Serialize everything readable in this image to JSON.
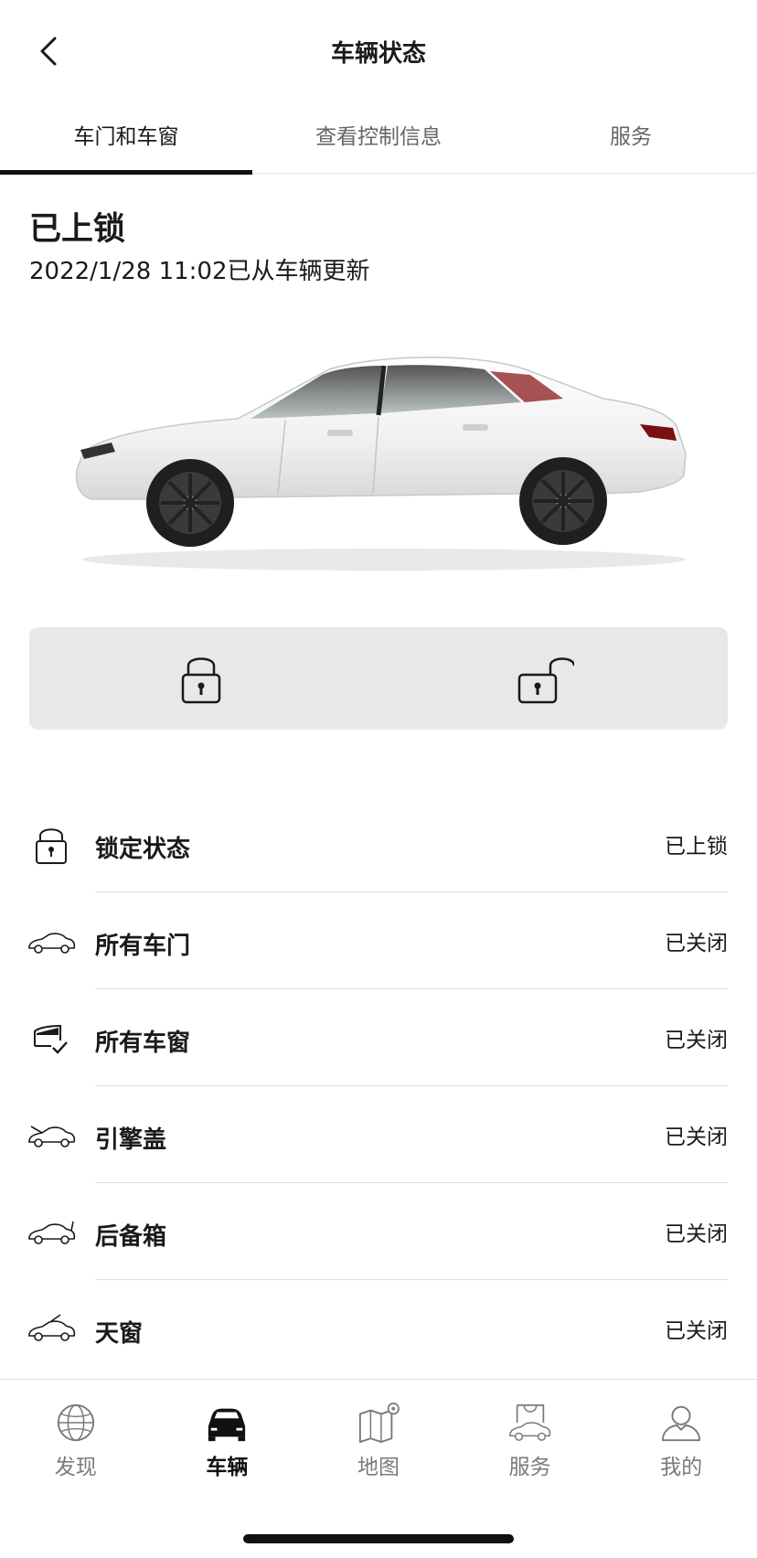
{
  "header": {
    "title": "车辆状态"
  },
  "tabs": [
    {
      "label": "车门和车窗",
      "active": true
    },
    {
      "label": "查看控制信息",
      "active": false
    },
    {
      "label": "服务",
      "active": false
    }
  ],
  "status": {
    "title": "已上锁",
    "updated": "2022/1/28 11:02已从车辆更新"
  },
  "lock_panel": {
    "lock_icon": "lock-closed-icon",
    "unlock_icon": "lock-open-icon"
  },
  "items": [
    {
      "icon": "lock-icon",
      "label": "锁定状态",
      "value": "已上锁"
    },
    {
      "icon": "car-door-icon",
      "label": "所有车门",
      "value": "已关闭"
    },
    {
      "icon": "car-window-icon",
      "label": "所有车窗",
      "value": "已关闭"
    },
    {
      "icon": "car-hood-icon",
      "label": "引擎盖",
      "value": "已关闭"
    },
    {
      "icon": "car-trunk-icon",
      "label": "后备箱",
      "value": "已关闭"
    },
    {
      "icon": "car-sunroof-icon",
      "label": "天窗",
      "value": "已关闭"
    }
  ],
  "nav": [
    {
      "label": "发现",
      "icon": "globe-icon",
      "active": false
    },
    {
      "label": "车辆",
      "icon": "car-icon",
      "active": true
    },
    {
      "label": "地图",
      "icon": "map-icon",
      "active": false
    },
    {
      "label": "服务",
      "icon": "service-bag-icon",
      "active": false
    },
    {
      "label": "我的",
      "icon": "profile-icon",
      "active": false
    }
  ],
  "colors": {
    "accent": "#111111",
    "panel_bg": "#e8e8e8",
    "muted_text": "#7a7a7a"
  }
}
